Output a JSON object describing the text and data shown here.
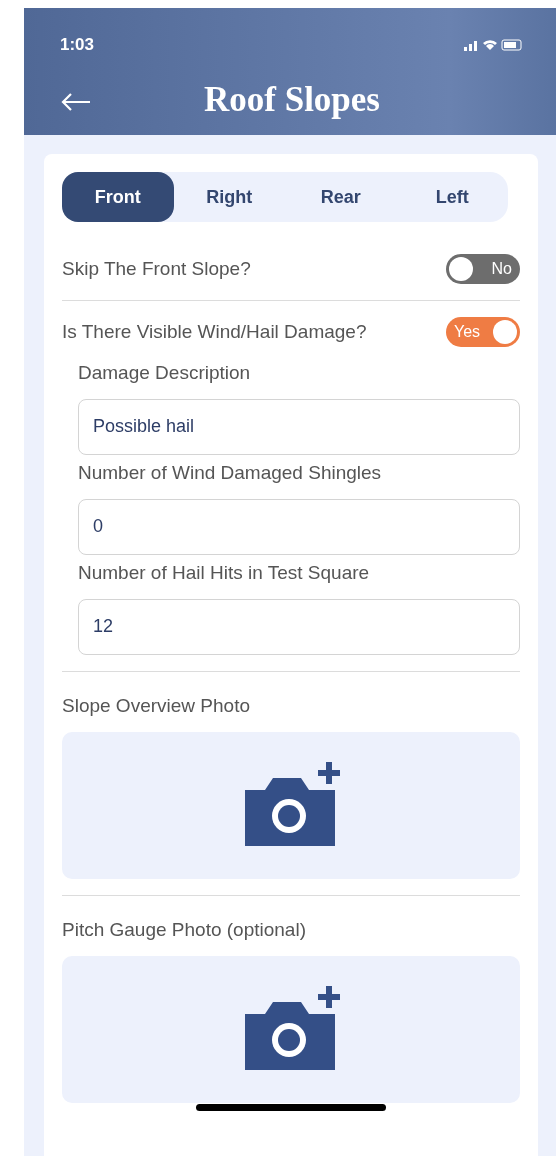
{
  "status_bar": {
    "time": "1:03"
  },
  "header": {
    "title": "Roof Slopes"
  },
  "tabs": [
    {
      "label": "Front",
      "selected": true
    },
    {
      "label": "Right",
      "selected": false
    },
    {
      "label": "Rear",
      "selected": false
    },
    {
      "label": "Left",
      "selected": false
    }
  ],
  "toggles": [
    {
      "label": "Skip The Front Slope?",
      "on": false,
      "text": "No"
    },
    {
      "label": "Is There Visible Wind/Hail Damage?",
      "on": true,
      "text": "Yes"
    }
  ],
  "fields": [
    {
      "label": "Damage Description",
      "value": "Possible hail"
    },
    {
      "label": "Number of Wind Damaged Shingles",
      "value": "0"
    },
    {
      "label": "Number of Hail Hits in Test Square",
      "value": "12"
    }
  ],
  "photos": [
    {
      "label": "Slope Overview Photo"
    },
    {
      "label": "Pitch Gauge Photo (optional)"
    }
  ]
}
